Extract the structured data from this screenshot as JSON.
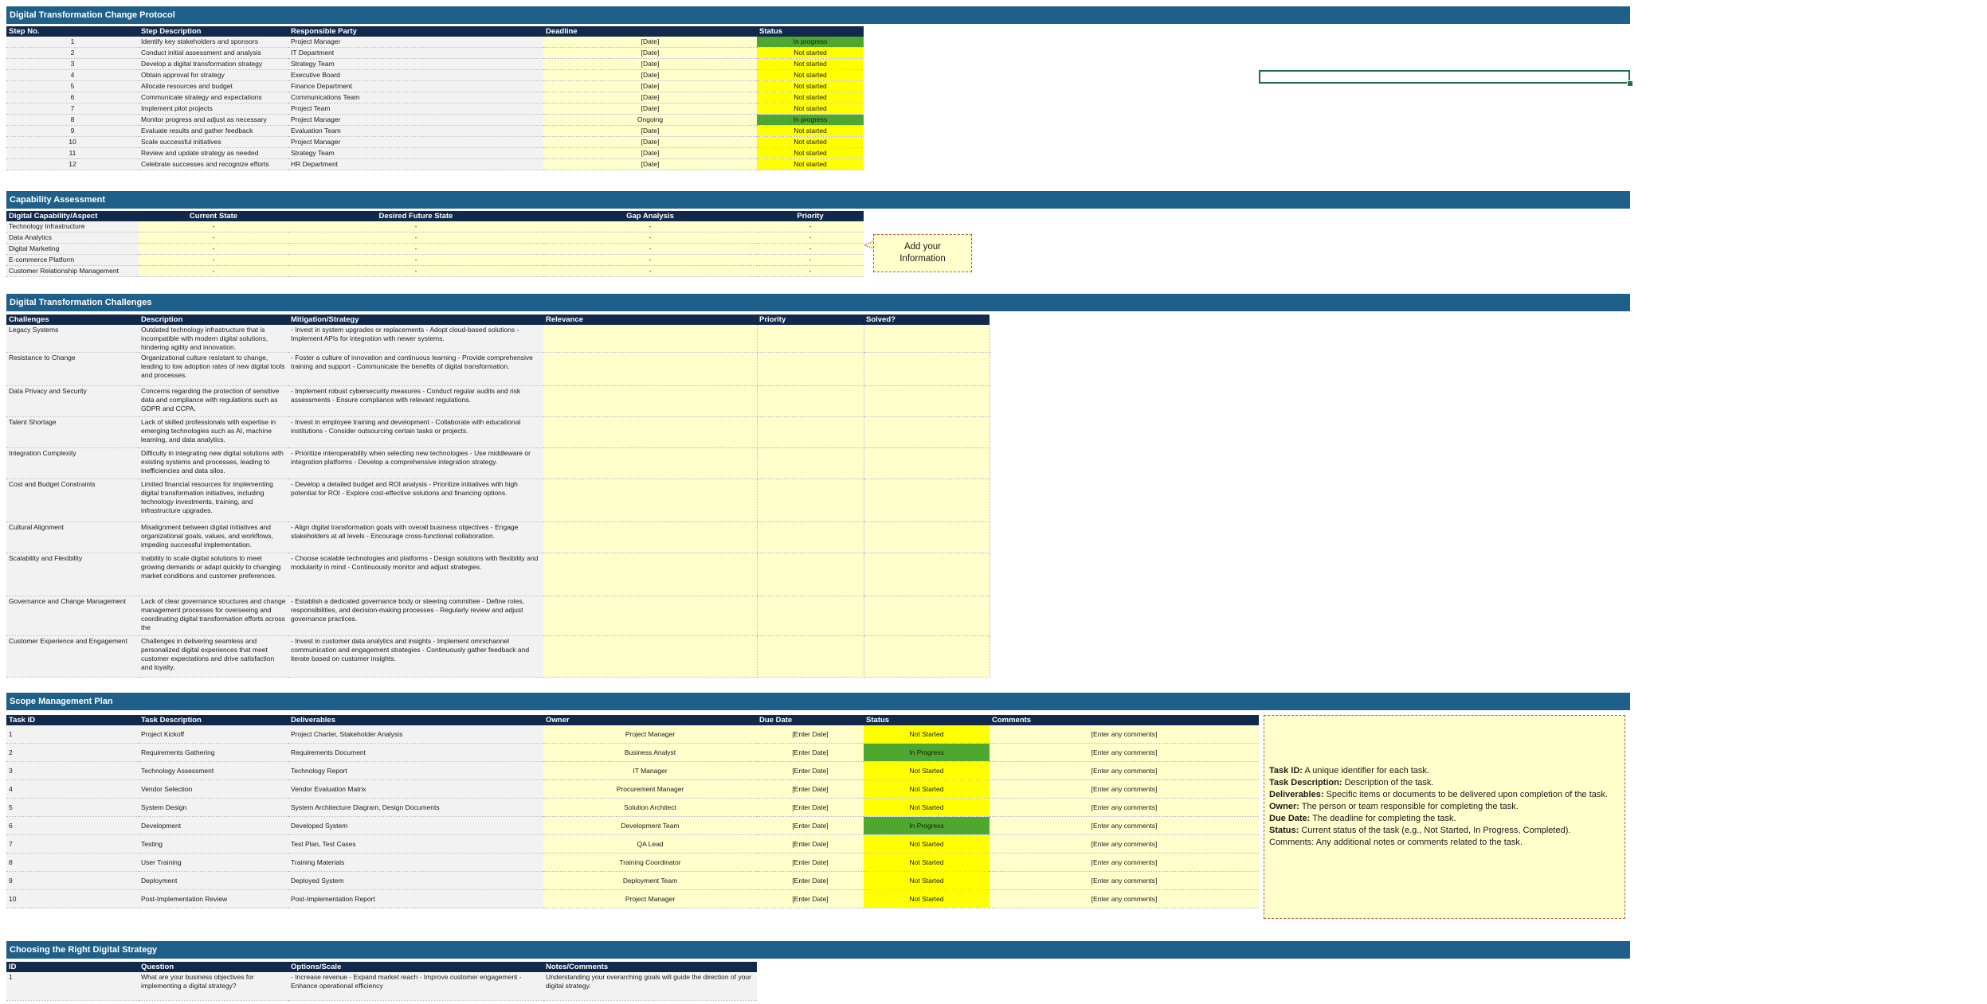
{
  "sections": {
    "protocol": "Digital Transformation Change Protocol",
    "capability": "Capability Assessment",
    "challenges": "Digital Transformation Challenges",
    "scope": "Scope Management Plan",
    "strategy": "Choosing the Right Digital Strategy"
  },
  "protocol": {
    "headers": [
      "Step No.",
      "Step Description",
      "Responsible Party",
      "Deadline",
      "Status"
    ],
    "rows": [
      [
        "1",
        "Identify key stakeholders and sponsors",
        "Project Manager",
        "[Date]",
        "In progress"
      ],
      [
        "2",
        "Conduct initial assessment and analysis",
        "IT Department",
        "[Date]",
        "Not started"
      ],
      [
        "3",
        "Develop a digital transformation strategy",
        "Strategy Team",
        "[Date]",
        "Not started"
      ],
      [
        "4",
        "Obtain approval for strategy",
        "Executive Board",
        "[Date]",
        "Not started"
      ],
      [
        "5",
        "Allocate resources and budget",
        "Finance Department",
        "[Date]",
        "Not started"
      ],
      [
        "6",
        "Communicate strategy and expectations",
        "Communications Team",
        "[Date]",
        "Not started"
      ],
      [
        "7",
        "Implement pilot projects",
        "Project Team",
        "[Date]",
        "Not started"
      ],
      [
        "8",
        "Monitor progress and adjust as necessary",
        "Project Manager",
        "Ongoing",
        "In progress"
      ],
      [
        "9",
        "Evaluate results and gather feedback",
        "Evaluation Team",
        "[Date]",
        "Not started"
      ],
      [
        "10",
        "Scale successful initiatives",
        "Project Manager",
        "[Date]",
        "Not started"
      ],
      [
        "11",
        "Review and update strategy as needed",
        "Strategy Team",
        "[Date]",
        "Not started"
      ],
      [
        "12",
        "Celebrate successes and recognize efforts",
        "HR Department",
        "[Date]",
        "Not started"
      ]
    ]
  },
  "capability": {
    "headers": [
      "Digital Capability/Aspect",
      "Current State",
      "Desired Future State",
      "Gap Analysis",
      "Priority"
    ],
    "rows": [
      [
        "Technology Infrastructure",
        "-",
        "-",
        "-",
        "-"
      ],
      [
        "Data Analytics",
        "-",
        "-",
        "-",
        "-"
      ],
      [
        "Digital Marketing",
        "-",
        "-",
        "-",
        "-"
      ],
      [
        "E-commerce Platform",
        "-",
        "-",
        "-",
        "-"
      ],
      [
        "Customer Relationship Management",
        "-",
        "-",
        "-",
        "-"
      ]
    ],
    "callout": "Add your Information"
  },
  "challenges": {
    "headers": [
      "Challenges",
      "Description",
      "Mitigation/Strategy",
      "Relevance",
      "Priority",
      "Solved?"
    ],
    "rows": [
      [
        "Legacy Systems",
        "Outdated technology infrastructure that is incompatible with modern digital solutions, hindering agility and innovation.",
        "- Invest in system upgrades or replacements - Adopt cloud-based solutions - Implement APIs for integration with newer systems."
      ],
      [
        "Resistance to Change",
        "Organizational culture resistant to change, leading to low adoption rates of new digital tools and processes.",
        "- Foster a culture of innovation and continuous learning - Provide comprehensive training and support - Communicate the benefits of digital transformation."
      ],
      [
        "Data Privacy and Security",
        "Concerns regarding the protection of sensitive data and compliance with regulations such as GDPR and CCPA.",
        "- Implement robust cybersecurity measures - Conduct regular audits and risk assessments - Ensure compliance with relevant regulations."
      ],
      [
        "Talent Shortage",
        "Lack of skilled professionals with expertise in emerging technologies such as AI, machine learning, and data analytics.",
        "- Invest in employee training and development - Collaborate with educational institutions - Consider outsourcing certain tasks or projects."
      ],
      [
        "Integration Complexity",
        "Difficulty in integrating new digital solutions with existing systems and processes, leading to inefficiencies and data silos.",
        "- Prioritize interoperability when selecting new technologies - Use middleware or integration platforms - Develop a comprehensive integration strategy."
      ],
      [
        "Cost and Budget Constraints",
        "Limited financial resources for implementing digital transformation initiatives, including technology investments, training, and infrastructure upgrades.",
        "- Develop a detailed budget and ROI analysis - Prioritize initiatives with high potential for ROI - Explore cost-effective solutions and financing options."
      ],
      [
        "Cultural Alignment",
        "Misalignment between digital initiatives and organizational goals, values, and workflows, impeding successful implementation.",
        "- Align digital transformation goals with overall business objectives - Engage stakeholders at all levels - Encourage cross-functional collaboration."
      ],
      [
        "Scalability and Flexibility",
        "Inability to scale digital solutions to meet growing demands or adapt quickly to changing market conditions and customer preferences.",
        "- Choose scalable technologies and platforms - Design solutions with flexibility and modularity in mind - Continuously monitor and adjust strategies."
      ],
      [
        "Governance and Change Management",
        "Lack of clear governance structures and change management processes for overseeing and coordinating digital transformation efforts across the",
        "- Establish a dedicated governance body or steering committee - Define roles, responsibilities, and decision-making processes - Regularly review and adjust governance practices."
      ],
      [
        "Customer Experience and Engagement",
        "Challenges in delivering seamless and personalized digital experiences that meet customer expectations and drive satisfaction and loyalty.",
        "- Invest in customer data analytics and insights - Implement omnichannel communication and engagement strategies - Continuously gather feedback and iterate based on customer insights."
      ]
    ]
  },
  "scope": {
    "headers": [
      "Task ID",
      "Task Description",
      "Deliverables",
      "Owner",
      "Due Date",
      "Status",
      "Comments"
    ],
    "rows": [
      [
        "1",
        "Project Kickoff",
        "Project Charter, Stakeholder Analysis",
        "Project Manager",
        "[Enter Date]",
        "Not Started",
        "[Enter any comments]"
      ],
      [
        "2",
        "Requirements Gathering",
        "Requirements Document",
        "Business Analyst",
        "[Enter Date]",
        "In Progress",
        "[Enter any comments]"
      ],
      [
        "3",
        "Technology Assessment",
        "Technology Report",
        "IT Manager",
        "[Enter Date]",
        "Not Started",
        "[Enter any comments]"
      ],
      [
        "4",
        "Vendor Selection",
        "Vendor Evaluation Matrix",
        "Procurement Manager",
        "[Enter Date]",
        "Not Started",
        "[Enter any comments]"
      ],
      [
        "5",
        "System Design",
        "System Architecture Diagram, Design Documents",
        "Solution Architect",
        "[Enter Date]",
        "Not Started",
        "[Enter any comments]"
      ],
      [
        "6",
        "Development",
        "Developed System",
        "Development Team",
        "[Enter Date]",
        "In Progress",
        "[Enter any comments]"
      ],
      [
        "7",
        "Testing",
        "Test Plan, Test Cases",
        "QA Lead",
        "[Enter Date]",
        "Not Started",
        "[Enter any comments]"
      ],
      [
        "8",
        "User Training",
        "Training Materials",
        "Training Coordinator",
        "[Enter Date]",
        "Not Started",
        "[Enter any comments]"
      ],
      [
        "9",
        "Deployment",
        "Deployed System",
        "Deployment Team",
        "[Enter Date]",
        "Not Started",
        "[Enter any comments]"
      ],
      [
        "10",
        "Post-Implementation Review",
        "Post-Implementation Report",
        "Project Manager",
        "[Enter Date]",
        "Not Started",
        "[Enter any comments]"
      ]
    ],
    "legend": [
      {
        "term": "Task ID:",
        "text": "A unique identifier for each task."
      },
      {
        "term": "Task Description:",
        "text": "Description of the task."
      },
      {
        "term": "Deliverables:",
        "text": "Specific items or documents to be delivered upon completion of the task."
      },
      {
        "term": "Owner:",
        "text": "The person or team responsible for completing the task."
      },
      {
        "term": "Due Date:",
        "text": "The deadline for completing the task."
      },
      {
        "term": "Status:",
        "text": "Current status of the task (e.g., Not Started, In Progress, Completed)."
      },
      {
        "term": "",
        "text": "Comments: Any additional notes or comments related to the task."
      }
    ]
  },
  "strategy": {
    "headers": [
      "ID",
      "Question",
      "Options/Scale",
      "Notes/Comments"
    ],
    "rows": [
      [
        "1",
        "What are your business objectives for implementing a digital strategy?",
        "- Increase revenue - Expand market reach - Improve customer engagement - Enhance operational efficiency",
        "Understanding your overarching goals will guide the direction of your digital strategy."
      ]
    ]
  },
  "colors": {
    "band": "#1e6089",
    "header": "#13294b",
    "in_progress": "#4ea72e",
    "not_started": "#ffff00",
    "input_fill": "#ffffcc"
  }
}
